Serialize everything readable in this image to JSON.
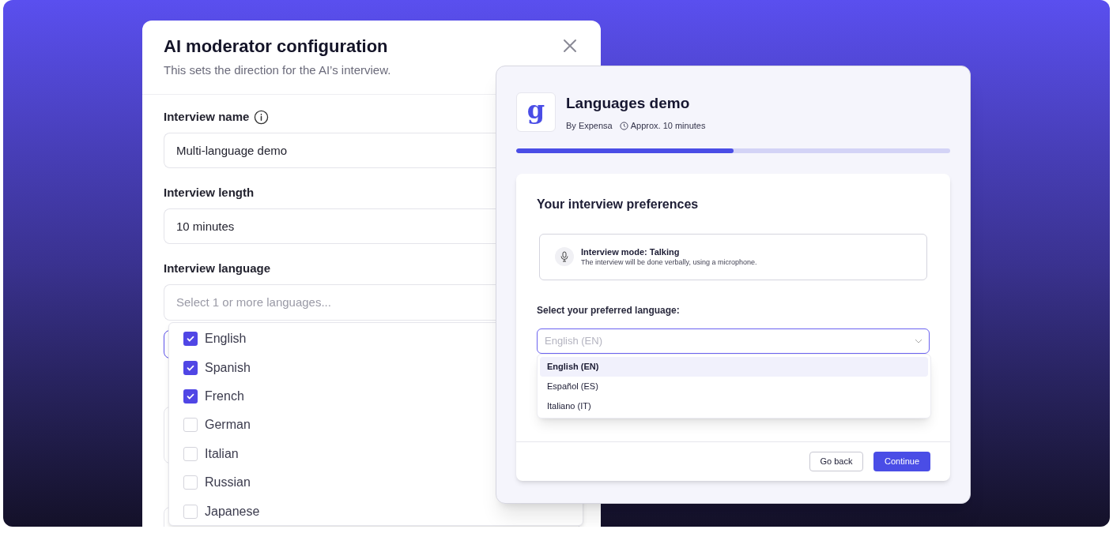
{
  "config_dialog": {
    "title": "AI moderator configuration",
    "subtitle": "This sets the direction for the AI’s interview.",
    "fields": [
      {
        "label": "Interview name",
        "has_info": true,
        "value": "Multi-language demo"
      },
      {
        "label": "Interview length",
        "has_info": false,
        "value": "10 minutes"
      },
      {
        "label": "Interview language",
        "has_info": false,
        "placeholder": "Select 1 or more languages..."
      }
    ],
    "language_options": [
      {
        "label": "English",
        "checked": true
      },
      {
        "label": "Spanish",
        "checked": true
      },
      {
        "label": "French",
        "checked": true
      },
      {
        "label": "German",
        "checked": false
      },
      {
        "label": "Italian",
        "checked": false
      },
      {
        "label": "Russian",
        "checked": false
      },
      {
        "label": "Japanese",
        "checked": false
      }
    ]
  },
  "preview": {
    "logo": "g",
    "title": "Languages demo",
    "author": "By Expensa",
    "duration": "Approx. 10 minutes",
    "progress": {
      "level": 0.5
    },
    "card": {
      "heading": "Your interview preferences",
      "mode_title": "Interview mode: Talking",
      "mode_description": "The interview will be done verbally, using a microphone.",
      "language_label": "Select your preferred language:",
      "select_placeholder": "English (EN)",
      "options": [
        {
          "label": "English (EN)",
          "selected": true
        },
        {
          "label": "Español (ES)",
          "selected": false
        },
        {
          "label": "Italiano (IT)",
          "selected": false
        }
      ],
      "buttons": [
        {
          "label": "Go back",
          "kind": "secondary"
        },
        {
          "label": "Continue",
          "kind": "primary"
        }
      ]
    }
  }
}
